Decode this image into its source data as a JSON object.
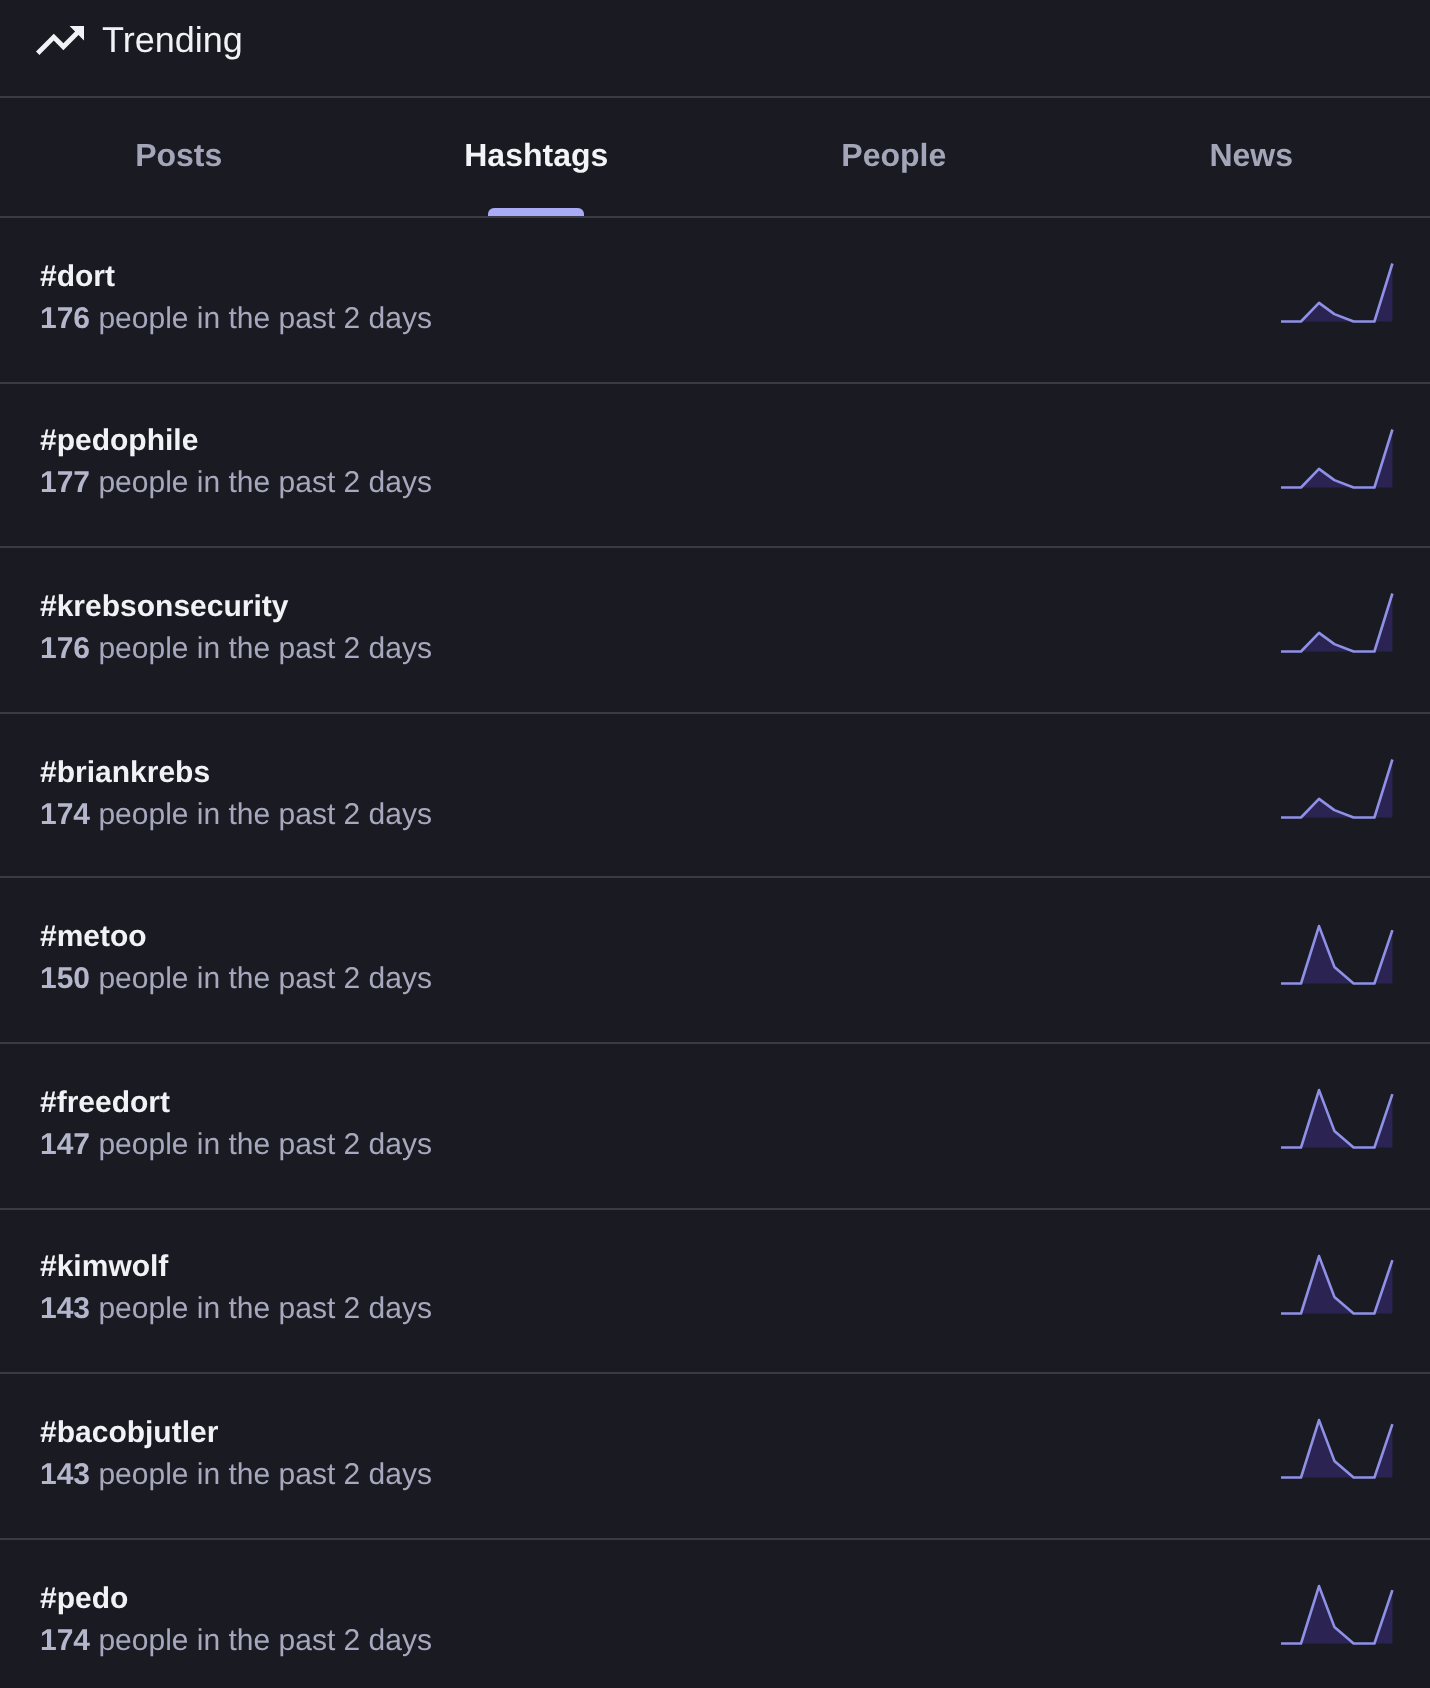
{
  "header": {
    "title": "Trending"
  },
  "tabs": [
    {
      "label": "Posts",
      "selected": false
    },
    {
      "label": "Hashtags",
      "selected": true
    },
    {
      "label": "People",
      "selected": false
    },
    {
      "label": "News",
      "selected": false
    }
  ],
  "hashtags": [
    {
      "tag": "#dort",
      "usage": "**176** people in the past 2 days",
      "sparkline": {
        "kind": "late-spike"
      }
    },
    {
      "tag": "#pedophile",
      "usage": "**177** people in the past 2 days",
      "sparkline": {
        "kind": "late-spike"
      }
    },
    {
      "tag": "#krebsonsecurity",
      "usage": "**176** people in the past 2 days",
      "sparkline": {
        "kind": "late-spike"
      }
    },
    {
      "tag": "#briankrebs",
      "usage": "**174** people in the past 2 days",
      "sparkline": {
        "kind": "late-spike"
      }
    },
    {
      "tag": "#metoo",
      "usage": "**150** people in the past 2 days",
      "sparkline": {
        "kind": "twin-peak"
      }
    },
    {
      "tag": "#freedort",
      "usage": "**147** people in the past 2 days",
      "sparkline": {
        "kind": "twin-peak"
      }
    },
    {
      "tag": "#kimwolf",
      "usage": "**143** people in the past 2 days",
      "sparkline": {
        "kind": "twin-peak"
      }
    },
    {
      "tag": "#bacobjutler",
      "usage": "**143** people in the past 2 days",
      "sparkline": {
        "kind": "twin-peak"
      }
    },
    {
      "tag": "#pedo",
      "usage": "**174** people in the past 2 days",
      "sparkline": {
        "kind": "twin-peak"
      }
    }
  ]
}
